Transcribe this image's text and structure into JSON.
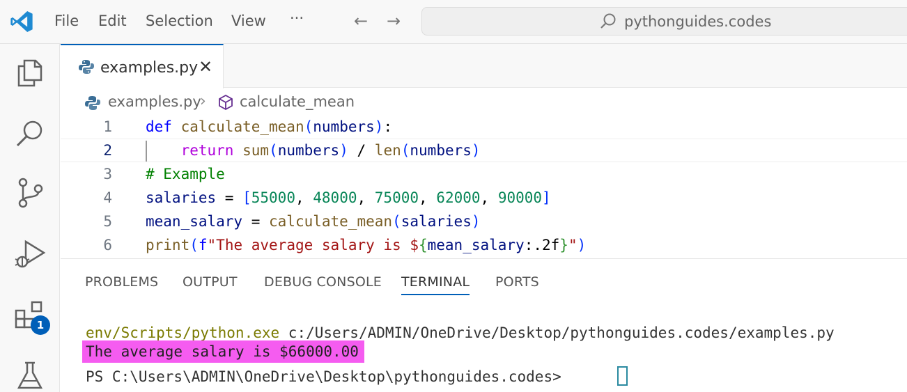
{
  "titlebar": {
    "menu": [
      "File",
      "Edit",
      "Selection",
      "View",
      "···"
    ],
    "search_text": "pythonguides.codes"
  },
  "activity_bar": {
    "extensions_badge": "1"
  },
  "tab": {
    "label": "examples.py",
    "close": "✕"
  },
  "breadcrumb": {
    "file": "examples.py",
    "separator": "›",
    "symbol": "calculate_mean"
  },
  "editor": {
    "line_numbers": [
      "1",
      "2",
      "3",
      "4",
      "5",
      "6"
    ],
    "active_line": 2
  },
  "panel": {
    "tabs": [
      "PROBLEMS",
      "OUTPUT",
      "DEBUG CONSOLE",
      "TERMINAL",
      "PORTS"
    ],
    "active_tab": "TERMINAL"
  },
  "terminal": {
    "line1_prefix": "env/Scripts/python.exe",
    "line1_rest": " c:/Users/ADMIN/OneDrive/Desktop/pythonguides.codes/examples.py",
    "output": "The average salary is $66000.00",
    "prompt": "PS C:\\Users\\ADMIN\\OneDrive\\Desktop\\pythonguides.codes>"
  },
  "colors": {
    "accent": "#005fb8",
    "highlight": "#f55cf0"
  }
}
